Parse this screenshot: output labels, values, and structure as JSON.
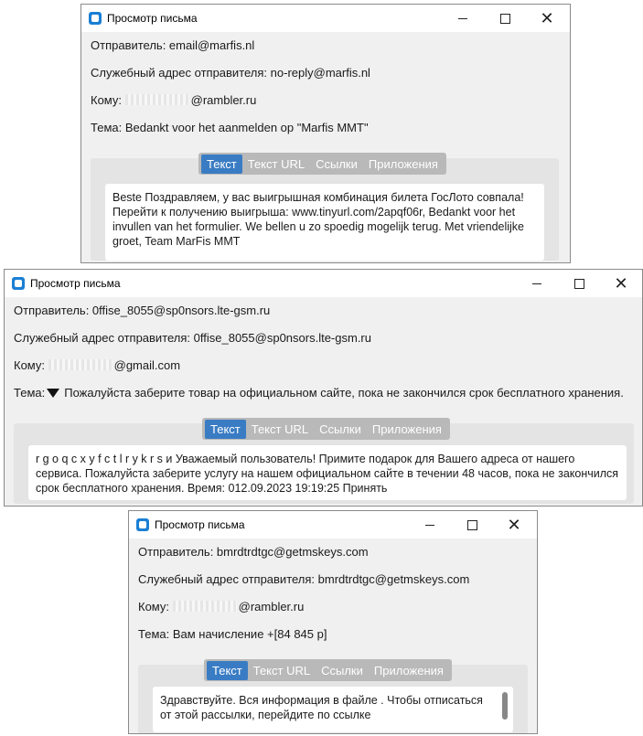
{
  "windows": [
    {
      "title": "Просмотр письма",
      "sender": "Отправитель: email@marfis.nl",
      "service_address": "Служебный адрес отправителя: no-reply@marfis.nl",
      "to_prefix": "Кому:",
      "to_domain": "@rambler.ru",
      "subject": "Тема: Bedankt voor het aanmelden op \"Marfis MMT\"",
      "tabs": [
        "Текст",
        "Текст URL",
        "Ссылки",
        "Приложения"
      ],
      "active_tab": "Текст",
      "body": "Beste Поздравляем, у вас выигрышная комбинация билета ГосЛото совпала! Перейти к получению выигрыша: www.tinyurl.com/2apqf06r, Bedankt voor het invullen van het formulier. We bellen u zo spoedig mogelijk terug. Met vriendelijke groet, Team MarFis MMT"
    },
    {
      "title": "Просмотр письма",
      "sender": "Отправитель: 0ffise_8055@sp0nsors.lte-gsm.ru",
      "service_address": "Служебный адрес отправителя: 0ffise_8055@sp0nsors.lte-gsm.ru",
      "to_prefix": "Кому:",
      "to_domain": "@gmail.com",
      "subject_prefix": "Тема:",
      "subject": "Пожалуйста заберите товар на официальном сайте, пока не закончился срок бесплатного хранения.",
      "tabs": [
        "Текст",
        "Текст URL",
        "Ссылки",
        "Приложения"
      ],
      "active_tab": "Текст",
      "body": "r g o q c x y f c t l r y k r s и Уважаемый пользователь! Примите подарок для Вашего адреса от нашего сервиса. Пожалуйста заберите услугу на нашем официальном сайте в течении 48 часов, пока не закончился срок бесплатного хранения. Время: 012.09.2023 19:19:25 Принять"
    },
    {
      "title": "Просмотр письма",
      "sender": "Отправитель: bmrdtrdtgc@getmskeys.com",
      "service_address": "Служебный адрес отправителя: bmrdtrdtgc@getmskeys.com",
      "to_prefix": "Кому:",
      "to_domain": "@rambler.ru",
      "subject": "Тема: Вам начисление +[84 845 р]",
      "tabs": [
        "Текст",
        "Текст URL",
        "Ссылки",
        "Приложения"
      ],
      "active_tab": "Текст",
      "body": "Здравствуйте. Вся информация в файле . Чтобы отписаться от этой рассылки, перейдите по ссылке"
    }
  ],
  "colors": {
    "accent_tab": "#3a7cc4",
    "tab_strip": "#b9b9b9",
    "window_bg": "#f0f0f0",
    "app_icon": "#1a7fd4"
  },
  "icons": {
    "app": "mail-viewer-app-icon",
    "minimize": "minimize-icon",
    "maximize": "maximize-icon",
    "close": "close-icon",
    "warning": "triangle-down-icon"
  }
}
